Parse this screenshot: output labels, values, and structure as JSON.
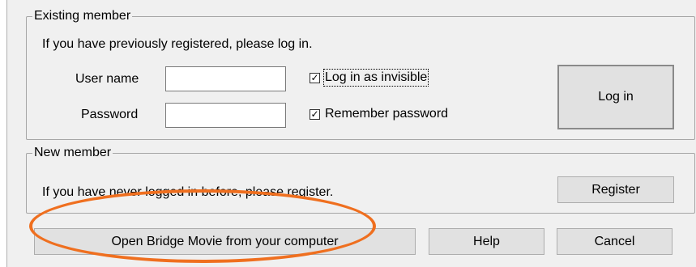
{
  "existing": {
    "legend": "Existing member",
    "intro": "If you have previously registered, please log in.",
    "username_label": "User name",
    "username_value": "",
    "password_label": "Password",
    "password_value": "",
    "invisible_label": "Log in as invisible",
    "invisible_checked": true,
    "remember_label": "Remember password",
    "remember_checked": true,
    "login_button": "Log in"
  },
  "new_member": {
    "legend": "New member",
    "intro": "If you have never logged in before, please register.",
    "register_button": "Register"
  },
  "footer": {
    "open_movie_button": "Open Bridge Movie from your computer",
    "help_button": "Help",
    "cancel_button": "Cancel"
  },
  "annotation": {
    "color": "#ef6f1f"
  }
}
